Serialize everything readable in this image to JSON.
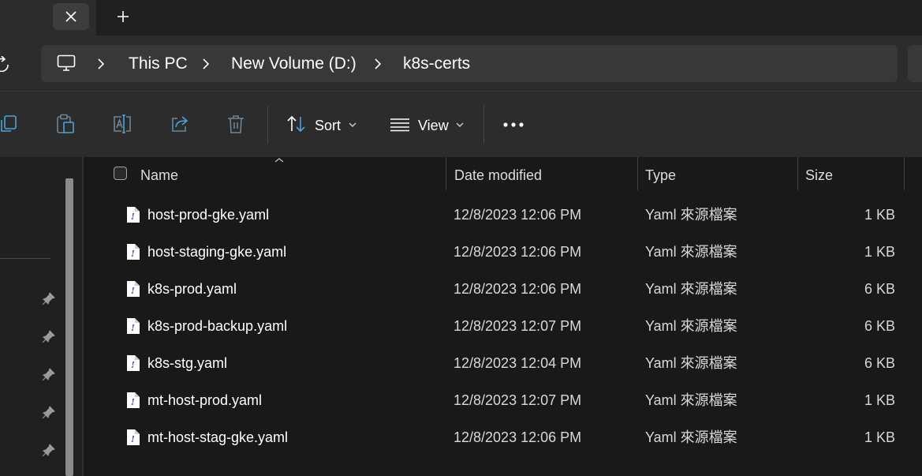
{
  "window": {
    "tab_close_icon": "close-icon",
    "new_tab_icon": "plus-icon"
  },
  "address": {
    "root_icon": "this-pc-icon",
    "breadcrumbs": [
      "This PC",
      "New Volume (D:)",
      "k8s-certs"
    ]
  },
  "toolbar": {
    "icons": [
      "copy-icon",
      "paste-icon",
      "rename-icon",
      "share-icon",
      "delete-icon"
    ],
    "sort_label": "Sort",
    "view_label": "View",
    "more_icon": "more-icon"
  },
  "columns": {
    "name": "Name",
    "date": "Date modified",
    "type": "Type",
    "size": "Size"
  },
  "files": [
    {
      "name": "host-prod-gke.yaml",
      "date": "12/8/2023 12:06 PM",
      "type": "Yaml 來源檔案",
      "size": "1 KB"
    },
    {
      "name": "host-staging-gke.yaml",
      "date": "12/8/2023 12:06 PM",
      "type": "Yaml 來源檔案",
      "size": "1 KB"
    },
    {
      "name": "k8s-prod.yaml",
      "date": "12/8/2023 12:06 PM",
      "type": "Yaml 來源檔案",
      "size": "6 KB"
    },
    {
      "name": "k8s-prod-backup.yaml",
      "date": "12/8/2023 12:07 PM",
      "type": "Yaml 來源檔案",
      "size": "6 KB"
    },
    {
      "name": "k8s-stg.yaml",
      "date": "12/8/2023 12:04 PM",
      "type": "Yaml 來源檔案",
      "size": "6 KB"
    },
    {
      "name": "mt-host-prod.yaml",
      "date": "12/8/2023 12:07 PM",
      "type": "Yaml 來源檔案",
      "size": "1 KB"
    },
    {
      "name": "mt-host-stag-gke.yaml",
      "date": "12/8/2023 12:06 PM",
      "type": "Yaml 來源檔案",
      "size": "1 KB"
    }
  ],
  "colors": {
    "background": "#191919",
    "toolbar": "#2c2c2c",
    "accent": "#60cdff"
  }
}
